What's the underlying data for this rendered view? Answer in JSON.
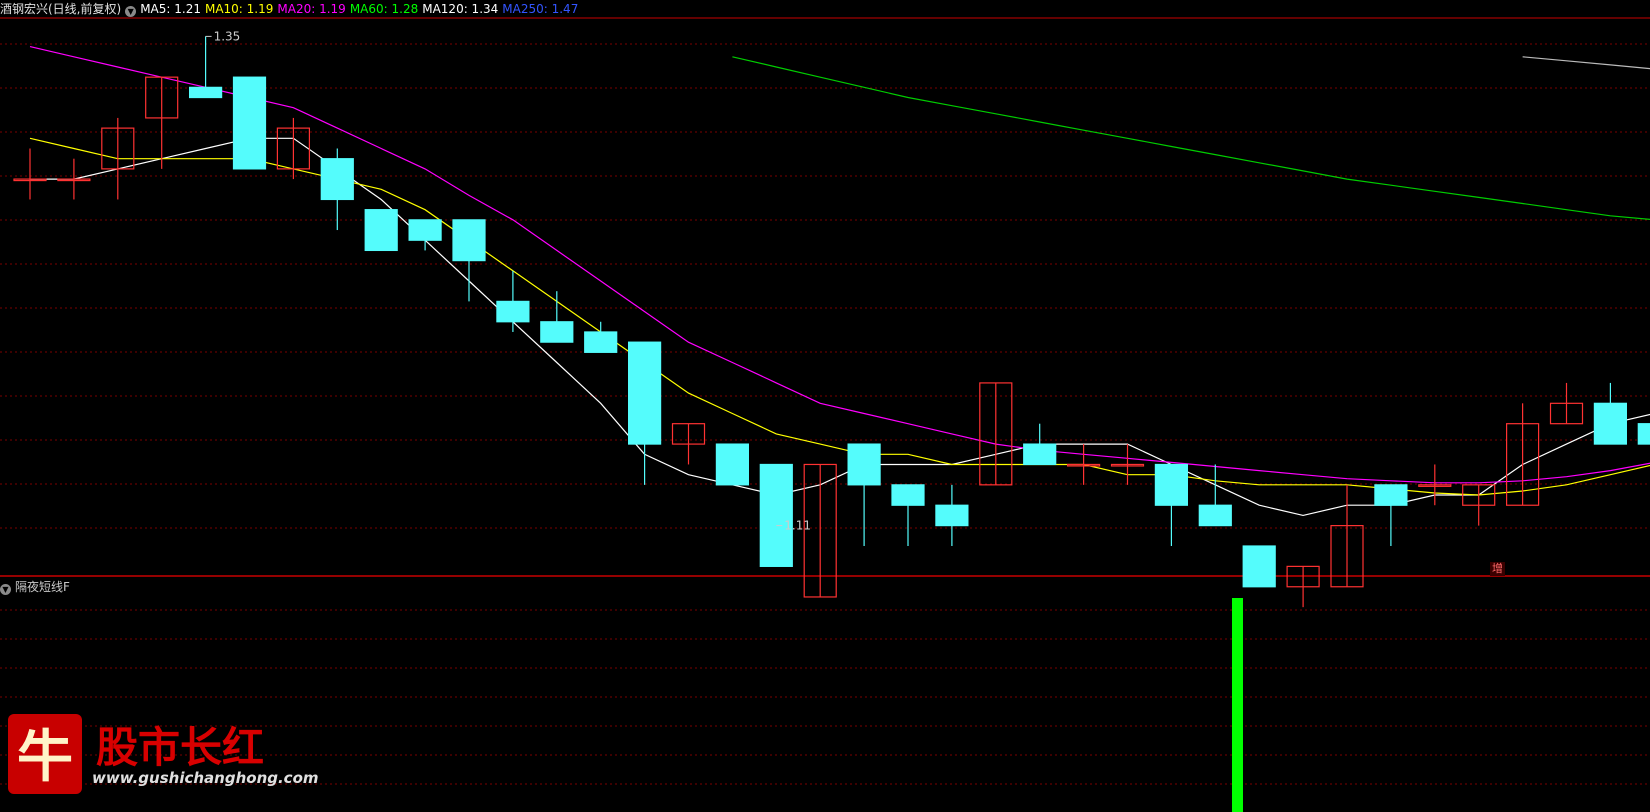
{
  "header": {
    "title": "酒钢宏兴(日线,前复权)",
    "ma": [
      {
        "label": "MA5: 1.21",
        "color": "#ffffff"
      },
      {
        "label": "MA10: 1.19",
        "color": "#ffff00"
      },
      {
        "label": "MA20: 1.19",
        "color": "#ff00ff"
      },
      {
        "label": "MA60: 1.28",
        "color": "#00ff00"
      },
      {
        "label": "MA120: 1.34",
        "color": "#ffffff"
      },
      {
        "label": "MA250: 1.47",
        "color": "#3355ff"
      }
    ]
  },
  "annotations": {
    "high": "1.35",
    "low": "1.11",
    "marker": "增"
  },
  "sub_panel": {
    "title": "隔夜短线F"
  },
  "watermark": {
    "brand": "股市长红",
    "url": "www.gushichanghong.com",
    "logo": "牛"
  },
  "colors": {
    "up": "#ff3232",
    "down": "#54fcfc",
    "grid": "#7a0000",
    "divider": "#c80000",
    "signal": "#00ff00"
  },
  "chart_data": {
    "type": "candlestick",
    "ylim": [
      1.1,
      1.36
    ],
    "candles": [
      {
        "o": 1.28,
        "h": 1.295,
        "l": 1.27,
        "c": 1.28
      },
      {
        "o": 1.28,
        "h": 1.29,
        "l": 1.27,
        "c": 1.28
      },
      {
        "o": 1.285,
        "h": 1.31,
        "l": 1.27,
        "c": 1.305
      },
      {
        "o": 1.31,
        "h": 1.33,
        "l": 1.285,
        "c": 1.33
      },
      {
        "o": 1.325,
        "h": 1.35,
        "l": 1.32,
        "c": 1.32
      },
      {
        "o": 1.33,
        "h": 1.33,
        "l": 1.285,
        "c": 1.285
      },
      {
        "o": 1.285,
        "h": 1.31,
        "l": 1.28,
        "c": 1.305
      },
      {
        "o": 1.29,
        "h": 1.295,
        "l": 1.255,
        "c": 1.27
      },
      {
        "o": 1.265,
        "h": 1.265,
        "l": 1.245,
        "c": 1.245
      },
      {
        "o": 1.26,
        "h": 1.26,
        "l": 1.245,
        "c": 1.25
      },
      {
        "o": 1.26,
        "h": 1.26,
        "l": 1.22,
        "c": 1.24
      },
      {
        "o": 1.22,
        "h": 1.235,
        "l": 1.205,
        "c": 1.21
      },
      {
        "o": 1.21,
        "h": 1.225,
        "l": 1.205,
        "c": 1.2
      },
      {
        "o": 1.205,
        "h": 1.21,
        "l": 1.195,
        "c": 1.195
      },
      {
        "o": 1.2,
        "h": 1.2,
        "l": 1.13,
        "c": 1.15
      },
      {
        "o": 1.15,
        "h": 1.16,
        "l": 1.14,
        "c": 1.16
      },
      {
        "o": 1.15,
        "h": 1.15,
        "l": 1.13,
        "c": 1.13
      },
      {
        "o": 1.14,
        "h": 1.14,
        "l": 1.11,
        "c": 1.09
      },
      {
        "o": 1.075,
        "h": 1.14,
        "l": 1.075,
        "c": 1.14
      },
      {
        "o": 1.15,
        "h": 1.15,
        "l": 1.1,
        "c": 1.13
      },
      {
        "o": 1.13,
        "h": 1.13,
        "l": 1.1,
        "c": 1.12
      },
      {
        "o": 1.12,
        "h": 1.13,
        "l": 1.1,
        "c": 1.11
      },
      {
        "o": 1.13,
        "h": 1.18,
        "l": 1.13,
        "c": 1.18
      },
      {
        "o": 1.15,
        "h": 1.16,
        "l": 1.14,
        "c": 1.14
      },
      {
        "o": 1.14,
        "h": 1.15,
        "l": 1.13,
        "c": 1.14
      },
      {
        "o": 1.14,
        "h": 1.15,
        "l": 1.13,
        "c": 1.14
      },
      {
        "o": 1.14,
        "h": 1.14,
        "l": 1.1,
        "c": 1.12
      },
      {
        "o": 1.12,
        "h": 1.14,
        "l": 1.11,
        "c": 1.11
      },
      {
        "o": 1.1,
        "h": 1.1,
        "l": 1.08,
        "c": 1.08
      },
      {
        "o": 1.08,
        "h": 1.09,
        "l": 1.07,
        "c": 1.09
      },
      {
        "o": 1.08,
        "h": 1.13,
        "l": 1.08,
        "c": 1.11
      },
      {
        "o": 1.13,
        "h": 1.13,
        "l": 1.1,
        "c": 1.12
      },
      {
        "o": 1.13,
        "h": 1.14,
        "l": 1.12,
        "c": 1.13
      },
      {
        "o": 1.12,
        "h": 1.13,
        "l": 1.11,
        "c": 1.13
      },
      {
        "o": 1.12,
        "h": 1.17,
        "l": 1.12,
        "c": 1.16
      },
      {
        "o": 1.16,
        "h": 1.18,
        "l": 1.16,
        "c": 1.17
      },
      {
        "o": 1.17,
        "h": 1.18,
        "l": 1.15,
        "c": 1.15
      },
      {
        "o": 1.16,
        "h": 1.17,
        "l": 1.15,
        "c": 1.15
      }
    ],
    "ma_lines": [
      {
        "name": "MA5",
        "color": "#ffffff",
        "values": [
          1.28,
          1.28,
          1.285,
          1.29,
          1.295,
          1.3,
          1.3,
          1.285,
          1.27,
          1.25,
          1.23,
          1.21,
          1.19,
          1.17,
          1.145,
          1.135,
          1.13,
          1.125,
          1.13,
          1.14,
          1.14,
          1.14,
          1.145,
          1.15,
          1.15,
          1.15,
          1.14,
          1.13,
          1.12,
          1.115,
          1.12,
          1.12,
          1.125,
          1.125,
          1.14,
          1.15,
          1.16,
          1.165
        ]
      },
      {
        "name": "MA10",
        "color": "#ffff00",
        "values": [
          1.3,
          1.295,
          1.29,
          1.29,
          1.29,
          1.29,
          1.285,
          1.28,
          1.275,
          1.265,
          1.25,
          1.235,
          1.22,
          1.205,
          1.19,
          1.175,
          1.165,
          1.155,
          1.15,
          1.145,
          1.145,
          1.14,
          1.14,
          1.14,
          1.14,
          1.135,
          1.135,
          1.132,
          1.13,
          1.13,
          1.13,
          1.128,
          1.126,
          1.125,
          1.127,
          1.13,
          1.135,
          1.14
        ]
      },
      {
        "name": "MA20",
        "color": "#ff00ff",
        "values": [
          1.345,
          1.34,
          1.335,
          1.33,
          1.325,
          1.32,
          1.315,
          1.305,
          1.295,
          1.285,
          1.272,
          1.26,
          1.245,
          1.23,
          1.215,
          1.2,
          1.19,
          1.18,
          1.17,
          1.165,
          1.16,
          1.155,
          1.15,
          1.147,
          1.145,
          1.143,
          1.141,
          1.139,
          1.137,
          1.135,
          1.133,
          1.132,
          1.131,
          1.131,
          1.132,
          1.134,
          1.137,
          1.141
        ]
      },
      {
        "name": "MA60",
        "color": "#00cc00",
        "values": [
          null,
          null,
          null,
          null,
          null,
          null,
          null,
          null,
          null,
          null,
          null,
          null,
          null,
          null,
          null,
          null,
          1.34,
          1.335,
          1.33,
          1.325,
          1.32,
          1.316,
          1.312,
          1.308,
          1.304,
          1.3,
          1.296,
          1.292,
          1.288,
          1.284,
          1.28,
          1.277,
          1.274,
          1.271,
          1.268,
          1.265,
          1.262,
          1.26
        ]
      },
      {
        "name": "MA120",
        "color": "#bbbbbb",
        "values": [
          null,
          null,
          null,
          null,
          null,
          null,
          null,
          null,
          null,
          null,
          null,
          null,
          null,
          null,
          null,
          null,
          null,
          null,
          null,
          null,
          null,
          null,
          null,
          null,
          null,
          null,
          null,
          null,
          null,
          null,
          null,
          null,
          null,
          null,
          1.34,
          1.338,
          1.336,
          1.334
        ]
      }
    ],
    "sub_bars": [
      {
        "index": 28,
        "value": 1
      }
    ]
  }
}
